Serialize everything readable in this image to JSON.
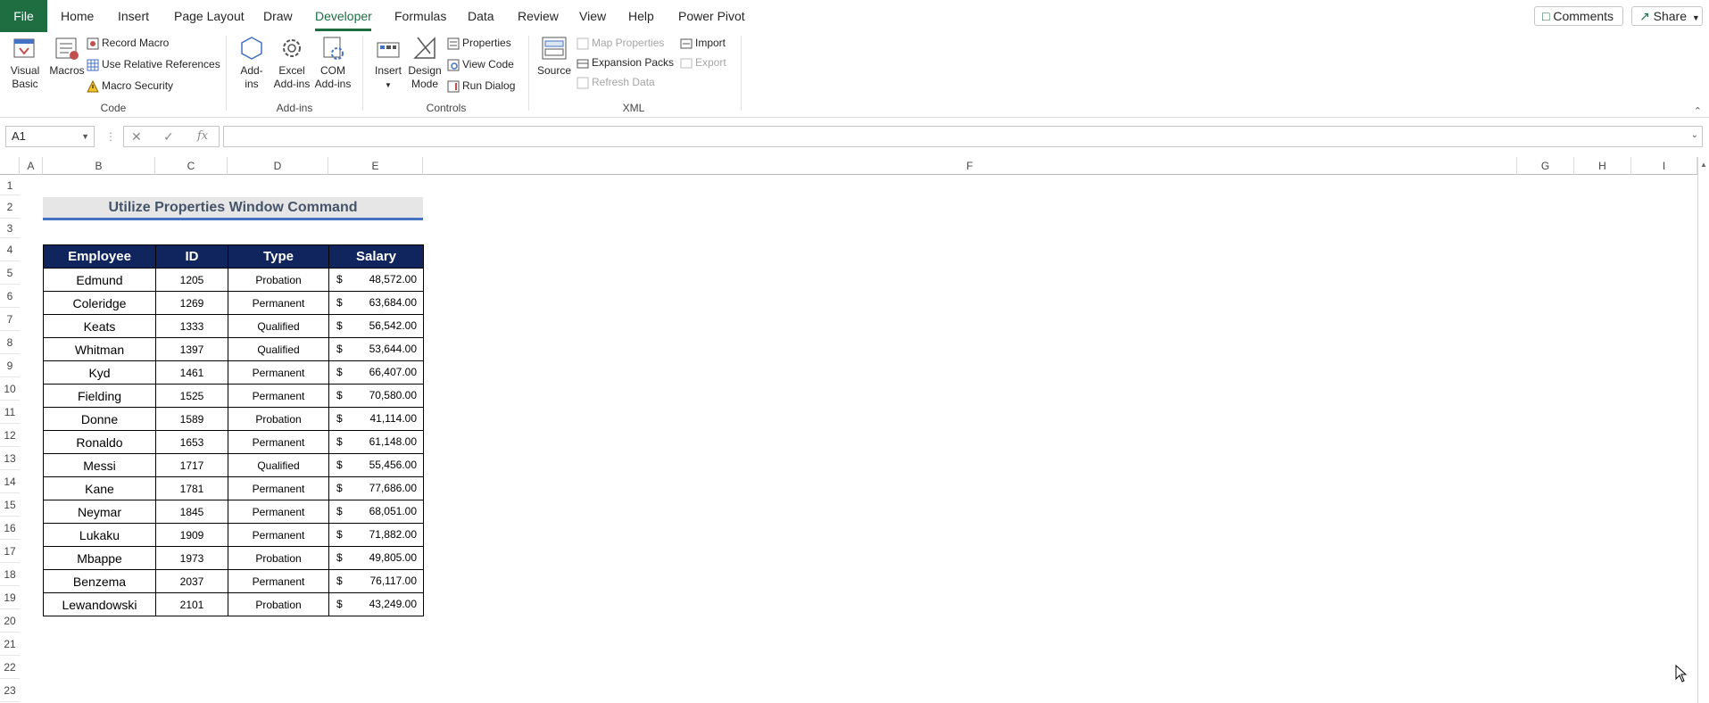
{
  "tabs": {
    "file": "File",
    "items": [
      "Home",
      "Insert",
      "Page Layout",
      "Draw",
      "Developer",
      "Formulas",
      "Data",
      "Review",
      "View",
      "Help",
      "Power Pivot"
    ],
    "active": "Developer"
  },
  "top_buttons": {
    "comments": "Comments",
    "share": "Share"
  },
  "ribbon": {
    "code": {
      "label": "Code",
      "visual_basic": [
        "Visual",
        "Basic"
      ],
      "macros": "Macros",
      "record_macro": "Record Macro",
      "use_relative": "Use Relative References",
      "macro_security": "Macro Security"
    },
    "addins": {
      "label": "Add-ins",
      "addins": [
        "Add-",
        "ins"
      ],
      "excel_addins": [
        "Excel",
        "Add-ins"
      ],
      "com_addins": [
        "COM",
        "Add-ins"
      ]
    },
    "controls": {
      "label": "Controls",
      "insert": "Insert",
      "design_mode": [
        "Design",
        "Mode"
      ],
      "properties": "Properties",
      "view_code": "View Code",
      "run_dialog": "Run Dialog"
    },
    "xml": {
      "label": "XML",
      "source": "Source",
      "map_properties": "Map Properties",
      "expansion_packs": "Expansion Packs",
      "refresh_data": "Refresh Data",
      "import": "Import",
      "export": "Export"
    }
  },
  "formula_bar": {
    "name_box": "A1",
    "fx": "fx",
    "value": ""
  },
  "columns": [
    "A",
    "B",
    "C",
    "D",
    "E",
    "F",
    "G",
    "H",
    "I"
  ],
  "rows": [
    "1",
    "2",
    "3",
    "4",
    "5",
    "6",
    "7",
    "8",
    "9",
    "10",
    "11",
    "12",
    "13",
    "14",
    "15",
    "16",
    "17",
    "18",
    "19",
    "20",
    "21",
    "22",
    "23"
  ],
  "sheet": {
    "title": "Utilize Properties Window Command",
    "headers": [
      "Employee",
      "ID",
      "Type",
      "Salary"
    ],
    "currency_symbol": "$",
    "records": [
      {
        "employee": "Edmund",
        "id": "1205",
        "type": "Probation",
        "salary": "48,572.00"
      },
      {
        "employee": "Coleridge",
        "id": "1269",
        "type": "Permanent",
        "salary": "63,684.00"
      },
      {
        "employee": "Keats",
        "id": "1333",
        "type": "Qualified",
        "salary": "56,542.00"
      },
      {
        "employee": "Whitman",
        "id": "1397",
        "type": "Qualified",
        "salary": "53,644.00"
      },
      {
        "employee": "Kyd",
        "id": "1461",
        "type": "Permanent",
        "salary": "66,407.00"
      },
      {
        "employee": "Fielding",
        "id": "1525",
        "type": "Permanent",
        "salary": "70,580.00"
      },
      {
        "employee": "Donne",
        "id": "1589",
        "type": "Probation",
        "salary": "41,114.00"
      },
      {
        "employee": "Ronaldo",
        "id": "1653",
        "type": "Permanent",
        "salary": "61,148.00"
      },
      {
        "employee": "Messi",
        "id": "1717",
        "type": "Qualified",
        "salary": "55,456.00"
      },
      {
        "employee": "Kane",
        "id": "1781",
        "type": "Permanent",
        "salary": "77,686.00"
      },
      {
        "employee": "Neymar",
        "id": "1845",
        "type": "Permanent",
        "salary": "68,051.00"
      },
      {
        "employee": "Lukaku",
        "id": "1909",
        "type": "Permanent",
        "salary": "71,882.00"
      },
      {
        "employee": "Mbappe",
        "id": "1973",
        "type": "Probation",
        "salary": "49,805.00"
      },
      {
        "employee": "Benzema",
        "id": "2037",
        "type": "Permanent",
        "salary": "76,117.00"
      },
      {
        "employee": "Lewandowski",
        "id": "2101",
        "type": "Probation",
        "salary": "43,249.00"
      }
    ]
  },
  "colors": {
    "accent": "#1e6e42",
    "header_fill": "#10255e",
    "title_fill": "#e7e6e6",
    "title_text": "#44546a",
    "title_underline": "#4472c4"
  }
}
